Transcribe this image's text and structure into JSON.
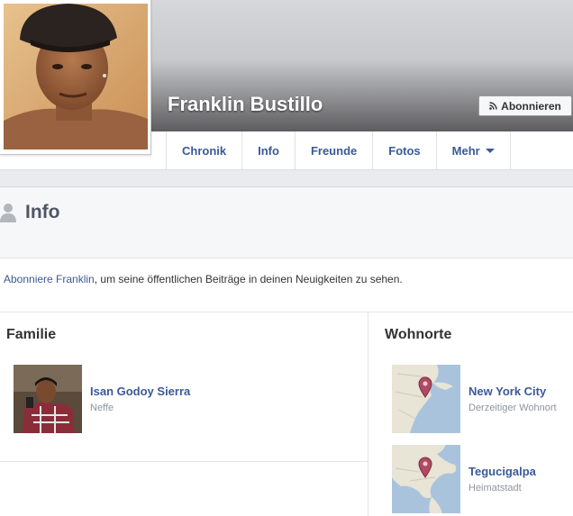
{
  "profile": {
    "name": "Franklin Bustillo",
    "subscribe_label": "Abonnieren"
  },
  "tabs": [
    {
      "label": "Chronik"
    },
    {
      "label": "Info"
    },
    {
      "label": "Freunde"
    },
    {
      "label": "Fotos"
    },
    {
      "label": "Mehr"
    }
  ],
  "info": {
    "title": "Info",
    "subscribe_link": "Abonniere Franklin",
    "subscribe_rest": ", um seine öffentlichen Beiträge in deinen Neuigkeiten zu sehen."
  },
  "family": {
    "title": "Familie",
    "members": [
      {
        "name": "Isan Godoy Sierra",
        "relation": "Neffe"
      }
    ]
  },
  "places": {
    "title": "Wohnorte",
    "items": [
      {
        "name": "New York City",
        "type": "Derzeitiger Wohnort"
      },
      {
        "name": "Tegucigalpa",
        "type": "Heimatstadt"
      }
    ]
  },
  "colors": {
    "link": "#3b5998",
    "muted": "#90949c",
    "map_pin": "#b04a63"
  },
  "icons": [
    "rss-icon",
    "person-icon",
    "map-pin-icon",
    "caret-down-icon"
  ]
}
